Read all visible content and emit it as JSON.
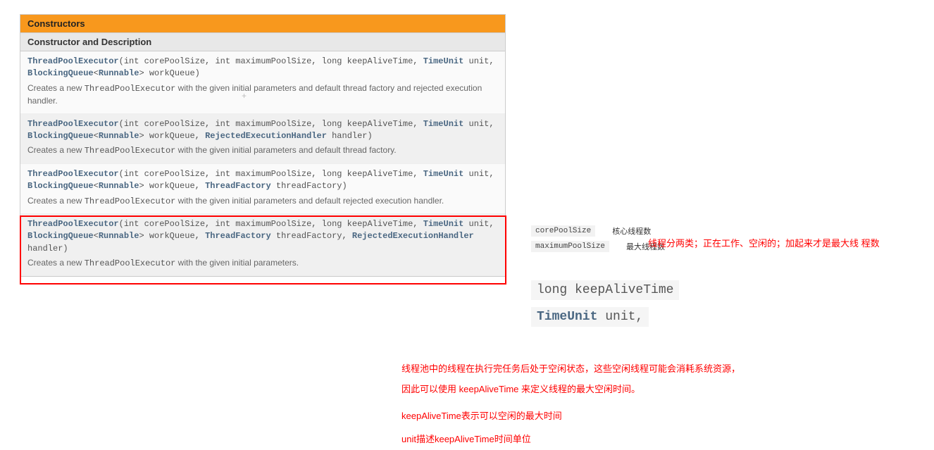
{
  "doc": {
    "tab": "Constructors",
    "subheader": "Constructor and Description",
    "rows": [
      {
        "sig_html": "<span class='kw'>ThreadPoolExecutor</span>(int corePoolSize, int maximumPoolSize, long keepAliveTime, <span class='lnk'>TimeUnit</span> unit, <span class='lnk'>BlockingQueue</span>&lt;<span class='lnk'>Runnable</span>&gt; workQueue)",
        "desc_html": "Creates a new <code>ThreadPoolExecutor</code> with the given initial parameters and default thread factory and rejected execution handler."
      },
      {
        "sig_html": "<span class='kw'>ThreadPoolExecutor</span>(int corePoolSize, int maximumPoolSize, long keepAliveTime, <span class='lnk'>TimeUnit</span> unit, <span class='lnk'>BlockingQueue</span>&lt;<span class='lnk'>Runnable</span>&gt; workQueue, <span class='lnk'>RejectedExecutionHandler</span> handler)",
        "desc_html": "Creates a new <code>ThreadPoolExecutor</code> with the given initial parameters and default thread factory."
      },
      {
        "sig_html": "<span class='kw'>ThreadPoolExecutor</span>(int corePoolSize, int maximumPoolSize, long keepAliveTime, <span class='lnk'>TimeUnit</span> unit, <span class='lnk'>BlockingQueue</span>&lt;<span class='lnk'>Runnable</span>&gt; workQueue, <span class='lnk'>ThreadFactory</span> threadFactory)",
        "desc_html": "Creates a new <code>ThreadPoolExecutor</code> with the given initial parameters and default rejected execution handler."
      },
      {
        "sig_html": "<span class='kw'>ThreadPoolExecutor</span>(int corePoolSize, int maximumPoolSize, long keepAliveTime, <span class='lnk'>TimeUnit</span> unit, <span class='lnk'>BlockingQueue</span>&lt;<span class='lnk'>Runnable</span>&gt; workQueue, <span class='lnk'>ThreadFactory</span> threadFactory, <span class='lnk'>RejectedExecutionHandler</span> handler)",
        "desc_html": "Creates a new <code>ThreadPoolExecutor</code> with the given initial parameters."
      }
    ]
  },
  "side": {
    "p1": "corePoolSize",
    "l1": "核心线程数",
    "p2": "maximumPoolSize",
    "l2": "最大线程数"
  },
  "note1": "线程分两类；正在工作、空闲的；加起来才是最大线 程数",
  "code": {
    "l1_html": "long keepAliveTime",
    "l2_html": "<span class='tp'>TimeUnit</span> unit,"
  },
  "red": {
    "p1": "线程池中的线程在执行完任务后处于空闲状态，这些空闲线程可能会消耗系统资源，",
    "p2": "因此可以使用 keepAliveTime 来定义线程的最大空闲时间。",
    "p3": "keepAliveTime表示可以空闲的最大时间",
    "p4": "unit描述keepAliveTime时间单位"
  }
}
